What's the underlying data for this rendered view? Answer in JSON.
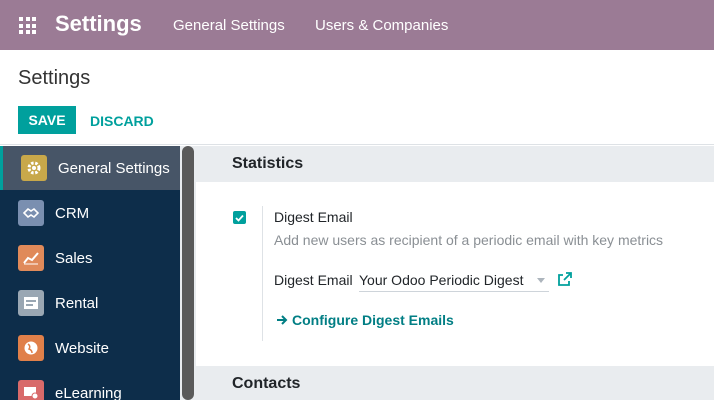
{
  "topbar": {
    "brand": "Settings",
    "menu": [
      "General Settings",
      "Users & Companies"
    ],
    "apps_icon": "apps-grid-icon"
  },
  "control_panel": {
    "title": "Settings",
    "save_label": "SAVE",
    "discard_label": "DISCARD"
  },
  "sidebar": {
    "items": [
      {
        "label": "General Settings",
        "icon": "gear-icon",
        "color": "#c8a84a",
        "active": true
      },
      {
        "label": "CRM",
        "icon": "handshake-icon",
        "color": "#7a8fb0"
      },
      {
        "label": "Sales",
        "icon": "chart-icon",
        "color": "#e08a5a"
      },
      {
        "label": "Rental",
        "icon": "rental-icon",
        "color": "#9aa7b3"
      },
      {
        "label": "Website",
        "icon": "globe-icon",
        "color": "#e0804a"
      },
      {
        "label": "eLearning",
        "icon": "elearning-icon",
        "color": "#d86a6a"
      }
    ]
  },
  "main": {
    "sections": [
      "Statistics",
      "Contacts"
    ],
    "setting": {
      "title": "Digest Email",
      "description": "Add new users as recipient of a periodic email with key metrics",
      "checked": true,
      "field_label": "Digest Email",
      "field_value": "Your Odoo Periodic Digest",
      "link_label": "Configure Digest Emails"
    }
  },
  "colors": {
    "topbar": "#9b7b95",
    "accent": "#00a09d",
    "sidebar": "#0d2d4a"
  }
}
